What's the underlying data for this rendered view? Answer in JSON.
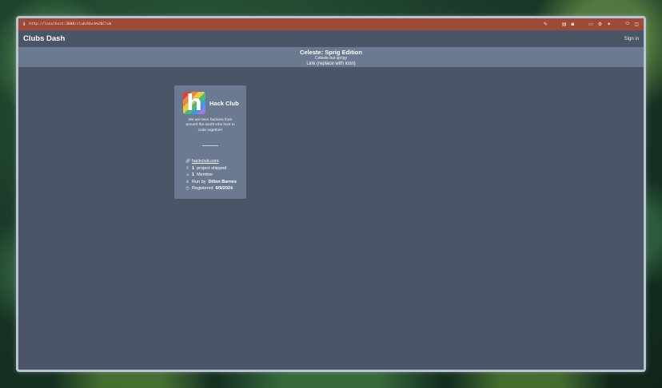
{
  "browser": {
    "url": "http://localhost:3000/club/Hack%20Club"
  },
  "app": {
    "brand": "Clubs Dash",
    "signin_label": "Sign in"
  },
  "announcement": {
    "title": "Celeste: Sprig Edition",
    "subtitle": "Celeste but sprigy",
    "link": "Link (replace with icon)"
  },
  "club": {
    "name": "Hack Club",
    "logo_letter": "h",
    "description": "We are teen hackers from around the world who love to code together!",
    "website": "hackclub.com",
    "projects_count": "1",
    "projects_suffix": "project shipped",
    "members_count": "1",
    "members_suffix": "Member",
    "run_by_prefix": "Run by",
    "run_by_name": "Dillon Barnes",
    "registered_prefix": "Registered",
    "registered_date": "6/9/2024"
  },
  "icons": {
    "info": "info-icon",
    "link": "link-icon",
    "ship": "ship-icon",
    "member": "member-icon",
    "person": "person-icon",
    "clock": "clock-icon"
  },
  "colors": {
    "page_bg": "#4a5568",
    "card_bg": "#6b7a90",
    "browser_bar": "#9c4a3a"
  }
}
